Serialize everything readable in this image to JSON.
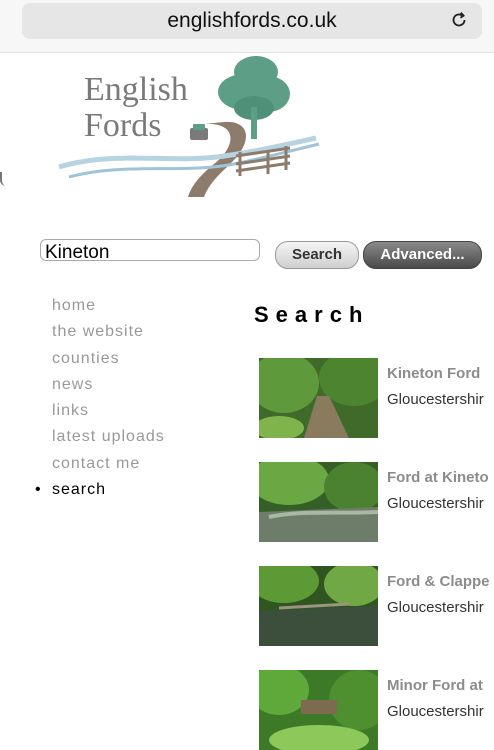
{
  "browser": {
    "url": "englishfords.co.uk"
  },
  "logo": {
    "line1": "English",
    "line2": "Fords"
  },
  "search": {
    "value": "Kineton",
    "button_label": "Search",
    "advanced_label": "Advanced..."
  },
  "nav": {
    "items": [
      {
        "label": "home",
        "active": false
      },
      {
        "label": "the website",
        "active": false
      },
      {
        "label": "counties",
        "active": false
      },
      {
        "label": "news",
        "active": false
      },
      {
        "label": "links",
        "active": false
      },
      {
        "label": "latest uploads",
        "active": false
      },
      {
        "label": "contact me",
        "active": false
      },
      {
        "label": "search",
        "active": true
      }
    ]
  },
  "main": {
    "heading": "Search",
    "results": [
      {
        "title": "Kineton Ford",
        "county": "Gloucestershir"
      },
      {
        "title": "Ford at Kineto",
        "county": "Gloucestershir"
      },
      {
        "title": "Ford & Clappe",
        "county": "Gloucestershir"
      },
      {
        "title": "Minor Ford at",
        "county": "Gloucestershir"
      }
    ]
  },
  "colors": {
    "logo_text": "#7a7a7a",
    "logo_tree": "#5d9e86",
    "logo_water": "#9fc4d8",
    "road": "#8d7b6c",
    "nav_text": "#999999"
  }
}
